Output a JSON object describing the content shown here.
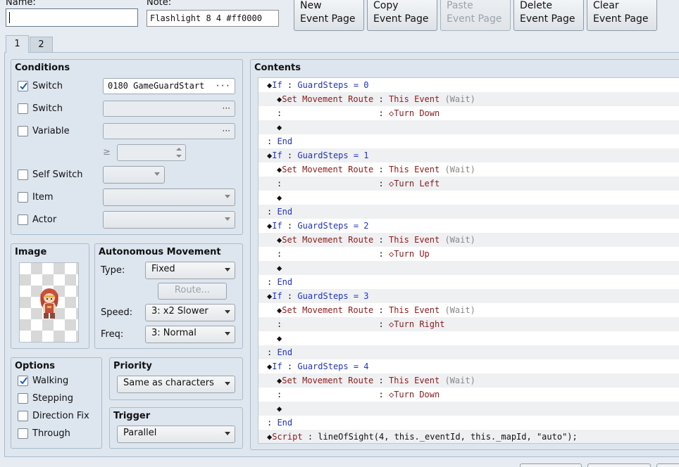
{
  "header": {
    "name_label": "Name:",
    "name_value": "",
    "note_label": "Note:",
    "note_value": "Flashlight 8 4 #ff0000"
  },
  "toolbar": {
    "new_page": [
      "New",
      "Event Page"
    ],
    "copy_page": [
      "Copy",
      "Event Page"
    ],
    "paste_page": [
      "Paste",
      "Event Page"
    ],
    "delete_page": [
      "Delete",
      "Event Page"
    ],
    "clear_page": [
      "Clear",
      "Event Page"
    ]
  },
  "tabs": [
    {
      "label": "1",
      "active": true
    },
    {
      "label": "2",
      "active": false
    }
  ],
  "conditions": {
    "title": "Conditions",
    "switch1": {
      "label": "Switch",
      "checked": true,
      "value": "0180 GameGuardStart"
    },
    "switch2": {
      "label": "Switch",
      "checked": false,
      "value": ""
    },
    "variable": {
      "label": "Variable",
      "checked": false,
      "value": ""
    },
    "variable_op": "≥",
    "self_switch": {
      "label": "Self Switch",
      "checked": false
    },
    "item": {
      "label": "Item",
      "checked": false
    },
    "actor": {
      "label": "Actor",
      "checked": false
    },
    "ellipsis": "···"
  },
  "image": {
    "title": "Image"
  },
  "autonomous": {
    "title": "Autonomous Movement",
    "type_label": "Type:",
    "type_value": "Fixed",
    "route_button": "Route...",
    "speed_label": "Speed:",
    "speed_value": "3: x2 Slower",
    "freq_label": "Freq:",
    "freq_value": "3: Normal"
  },
  "options": {
    "title": "Options",
    "walking": {
      "label": "Walking",
      "checked": true
    },
    "stepping": {
      "label": "Stepping",
      "checked": false
    },
    "direction_fix": {
      "label": "Direction Fix",
      "checked": false
    },
    "through": {
      "label": "Through",
      "checked": false
    }
  },
  "priority": {
    "title": "Priority",
    "value": "Same as characters"
  },
  "trigger": {
    "title": "Trigger",
    "value": "Parallel"
  },
  "contents": {
    "title": "Contents",
    "rows": [
      {
        "indent": 0,
        "parts": [
          [
            "k",
            "◆"
          ],
          [
            "b",
            "If"
          ],
          [
            "k",
            " : "
          ],
          [
            "b",
            "GuardSteps = 0"
          ]
        ]
      },
      {
        "indent": 1,
        "parts": [
          [
            "k",
            "◆"
          ],
          [
            "r",
            "Set Movement Route"
          ],
          [
            "k",
            " : "
          ],
          [
            "r",
            "This Event "
          ],
          [
            "g",
            "(Wait)"
          ]
        ]
      },
      {
        "indent": 1,
        "parts": [
          [
            "k",
            ":"
          ],
          [
            "pad",
            "                   "
          ],
          [
            "k",
            ": "
          ],
          [
            "r",
            "◇Turn Down"
          ]
        ]
      },
      {
        "indent": 1,
        "parts": [
          [
            "k",
            "◆"
          ]
        ]
      },
      {
        "indent": 0,
        "parts": [
          [
            "k",
            ": "
          ],
          [
            "b",
            "End"
          ]
        ]
      },
      {
        "indent": 0,
        "parts": [
          [
            "k",
            "◆"
          ],
          [
            "b",
            "If"
          ],
          [
            "k",
            " : "
          ],
          [
            "b",
            "GuardSteps = 1"
          ]
        ]
      },
      {
        "indent": 1,
        "parts": [
          [
            "k",
            "◆"
          ],
          [
            "r",
            "Set Movement Route"
          ],
          [
            "k",
            " : "
          ],
          [
            "r",
            "This Event "
          ],
          [
            "g",
            "(Wait)"
          ]
        ]
      },
      {
        "indent": 1,
        "parts": [
          [
            "k",
            ":"
          ],
          [
            "pad",
            "                   "
          ],
          [
            "k",
            ": "
          ],
          [
            "r",
            "◇Turn Left"
          ]
        ]
      },
      {
        "indent": 1,
        "parts": [
          [
            "k",
            "◆"
          ]
        ]
      },
      {
        "indent": 0,
        "parts": [
          [
            "k",
            ": "
          ],
          [
            "b",
            "End"
          ]
        ]
      },
      {
        "indent": 0,
        "parts": [
          [
            "k",
            "◆"
          ],
          [
            "b",
            "If"
          ],
          [
            "k",
            " : "
          ],
          [
            "b",
            "GuardSteps = 2"
          ]
        ]
      },
      {
        "indent": 1,
        "parts": [
          [
            "k",
            "◆"
          ],
          [
            "r",
            "Set Movement Route"
          ],
          [
            "k",
            " : "
          ],
          [
            "r",
            "This Event "
          ],
          [
            "g",
            "(Wait)"
          ]
        ]
      },
      {
        "indent": 1,
        "parts": [
          [
            "k",
            ":"
          ],
          [
            "pad",
            "                   "
          ],
          [
            "k",
            ": "
          ],
          [
            "r",
            "◇Turn Up"
          ]
        ]
      },
      {
        "indent": 1,
        "parts": [
          [
            "k",
            "◆"
          ]
        ]
      },
      {
        "indent": 0,
        "parts": [
          [
            "k",
            ": "
          ],
          [
            "b",
            "End"
          ]
        ]
      },
      {
        "indent": 0,
        "parts": [
          [
            "k",
            "◆"
          ],
          [
            "b",
            "If"
          ],
          [
            "k",
            " : "
          ],
          [
            "b",
            "GuardSteps = 3"
          ]
        ]
      },
      {
        "indent": 1,
        "parts": [
          [
            "k",
            "◆"
          ],
          [
            "r",
            "Set Movement Route"
          ],
          [
            "k",
            " : "
          ],
          [
            "r",
            "This Event "
          ],
          [
            "g",
            "(Wait)"
          ]
        ]
      },
      {
        "indent": 1,
        "parts": [
          [
            "k",
            ":"
          ],
          [
            "pad",
            "                   "
          ],
          [
            "k",
            ": "
          ],
          [
            "r",
            "◇Turn Right"
          ]
        ]
      },
      {
        "indent": 1,
        "parts": [
          [
            "k",
            "◆"
          ]
        ]
      },
      {
        "indent": 0,
        "parts": [
          [
            "k",
            ": "
          ],
          [
            "b",
            "End"
          ]
        ]
      },
      {
        "indent": 0,
        "parts": [
          [
            "k",
            "◆"
          ],
          [
            "b",
            "If"
          ],
          [
            "k",
            " : "
          ],
          [
            "b",
            "GuardSteps = 4"
          ]
        ]
      },
      {
        "indent": 1,
        "parts": [
          [
            "k",
            "◆"
          ],
          [
            "r",
            "Set Movement Route"
          ],
          [
            "k",
            " : "
          ],
          [
            "r",
            "This Event "
          ],
          [
            "g",
            "(Wait)"
          ]
        ]
      },
      {
        "indent": 1,
        "parts": [
          [
            "k",
            ":"
          ],
          [
            "pad",
            "                   "
          ],
          [
            "k",
            ": "
          ],
          [
            "r",
            "◇Turn Down"
          ]
        ]
      },
      {
        "indent": 1,
        "parts": [
          [
            "k",
            "◆"
          ]
        ]
      },
      {
        "indent": 0,
        "parts": [
          [
            "k",
            ": "
          ],
          [
            "b",
            "End"
          ]
        ]
      },
      {
        "indent": 0,
        "parts": [
          [
            "k",
            "◆"
          ],
          [
            "r",
            "Script"
          ],
          [
            "k",
            " : "
          ],
          [
            "k",
            "lineOfSight(4, this._eventId, this._mapId, \"auto\");"
          ]
        ]
      }
    ]
  },
  "colors": {
    "keyword_blue": "#2233bb",
    "command_red": "#8b1a1a",
    "paren_gray": "#888888",
    "check_blue": "#1a5fb4"
  }
}
